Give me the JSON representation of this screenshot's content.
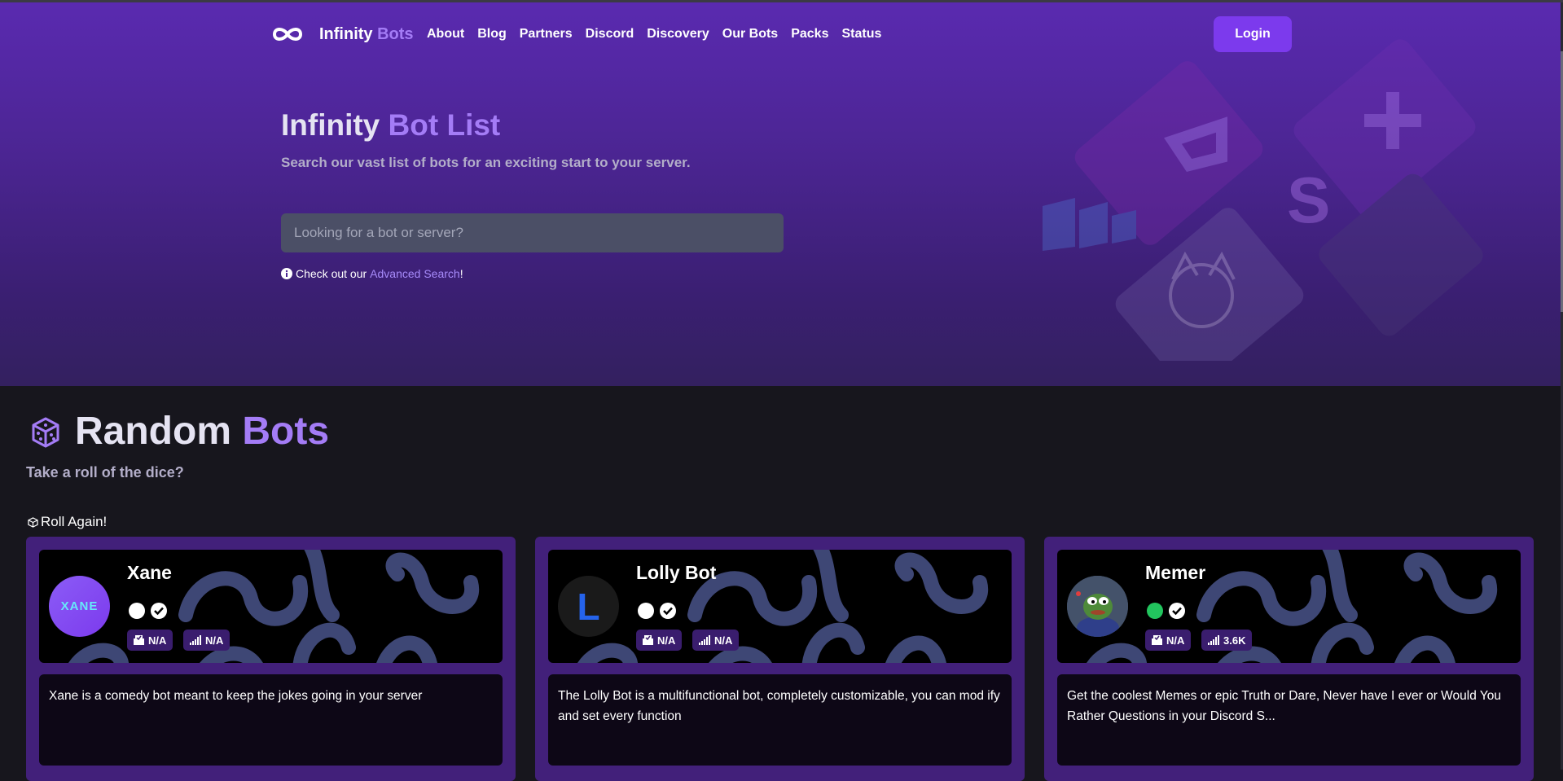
{
  "nav": {
    "brand_main": "Infinity",
    "brand_accent": "Bots",
    "links": [
      "About",
      "Blog",
      "Partners",
      "Discord",
      "Discovery",
      "Our Bots",
      "Packs",
      "Status"
    ],
    "login_label": "Login"
  },
  "hero": {
    "title_main": "Infinity",
    "title_accent": "Bot List",
    "subtitle": "Search our vast list of bots for an exciting start to your server.",
    "search_placeholder": "Looking for a bot or server?",
    "advanced_prefix": "Check out our",
    "advanced_link": "Advanced Search",
    "advanced_suffix": "!"
  },
  "random": {
    "title_main": "Random",
    "title_accent": "Bots",
    "subtitle": "Take a roll of the dice?",
    "roll_label": "Roll Again!"
  },
  "cards": [
    {
      "name": "Xane",
      "avatar_text": "XANE",
      "status_color": "#ffffff",
      "votes": "N/A",
      "servers": "N/A",
      "description": "Xane is a comedy bot meant to keep the jokes going in your server"
    },
    {
      "name": "Lolly Bot",
      "avatar_text": "L",
      "status_color": "#ffffff",
      "votes": "N/A",
      "servers": "N/A",
      "description": "The Lolly Bot is a multifunctional bot, completely customizable, you can mod ify and set every function"
    },
    {
      "name": "Memer",
      "avatar_text": "",
      "status_color": "#22c55e",
      "votes": "N/A",
      "servers": "3.6K",
      "description": "Get the coolest Memes or epic Truth or Dare, Never have I ever or Would You Rather Questions in your Discord S..."
    }
  ],
  "colors": {
    "accent": "#a47cf6",
    "button": "#7c3aed",
    "card": "#42207a",
    "background": "#17161d"
  }
}
